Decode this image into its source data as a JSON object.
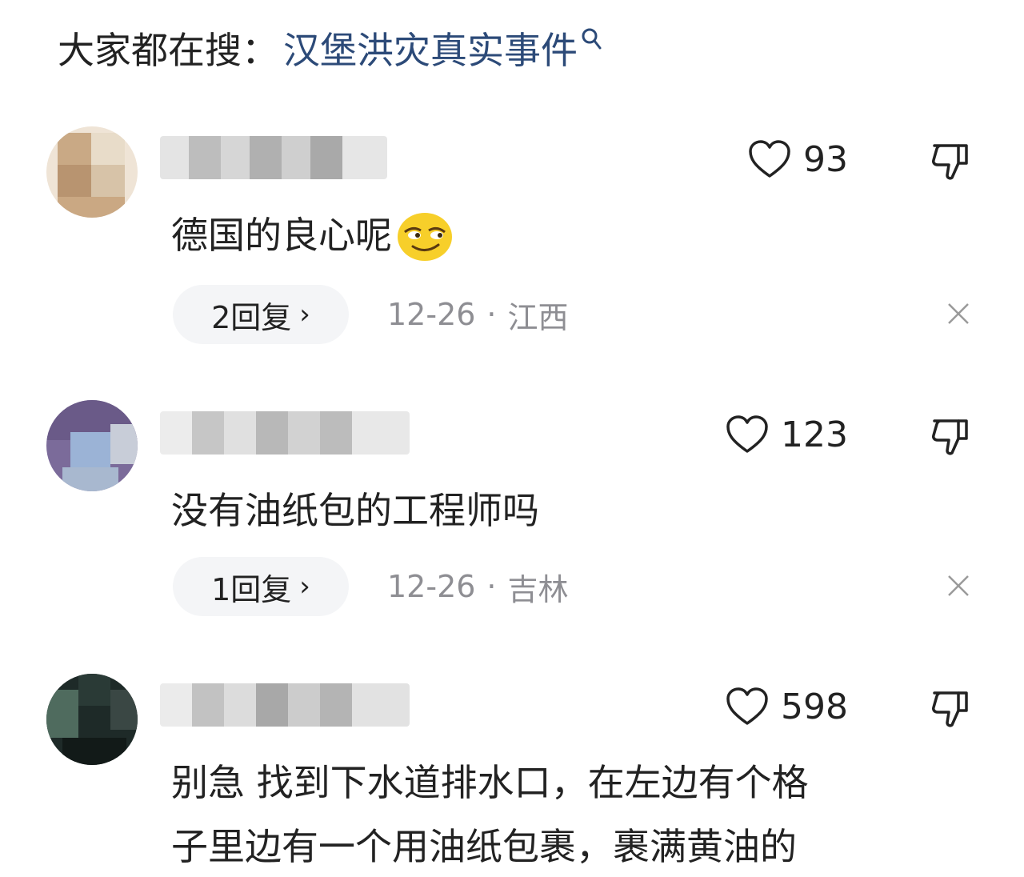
{
  "search": {
    "prefix": "大家都在搜：",
    "keyword": "汉堡洪灾真实事件",
    "icon": "search-icon"
  },
  "comments": [
    {
      "likes": "93",
      "text": "德国的良心呢",
      "emoji": "smirk-emoji",
      "reply_label": "2回复",
      "date": "12-26",
      "location": "江西"
    },
    {
      "likes": "123",
      "text": "没有油纸包的工程师吗",
      "reply_label": "1回复",
      "date": "12-26",
      "location": "吉林"
    },
    {
      "likes": "598",
      "text_line1": "别急 找到下水道排水口，在左边有个格",
      "text_line2": "子里边有一个用油纸包裹，裹满黄油的"
    }
  ],
  "meta_separator": "·",
  "colors": {
    "search_keyword": "#2c4a78",
    "meta_text": "#8e8e93",
    "reply_pill_bg": "#f4f5f7"
  }
}
